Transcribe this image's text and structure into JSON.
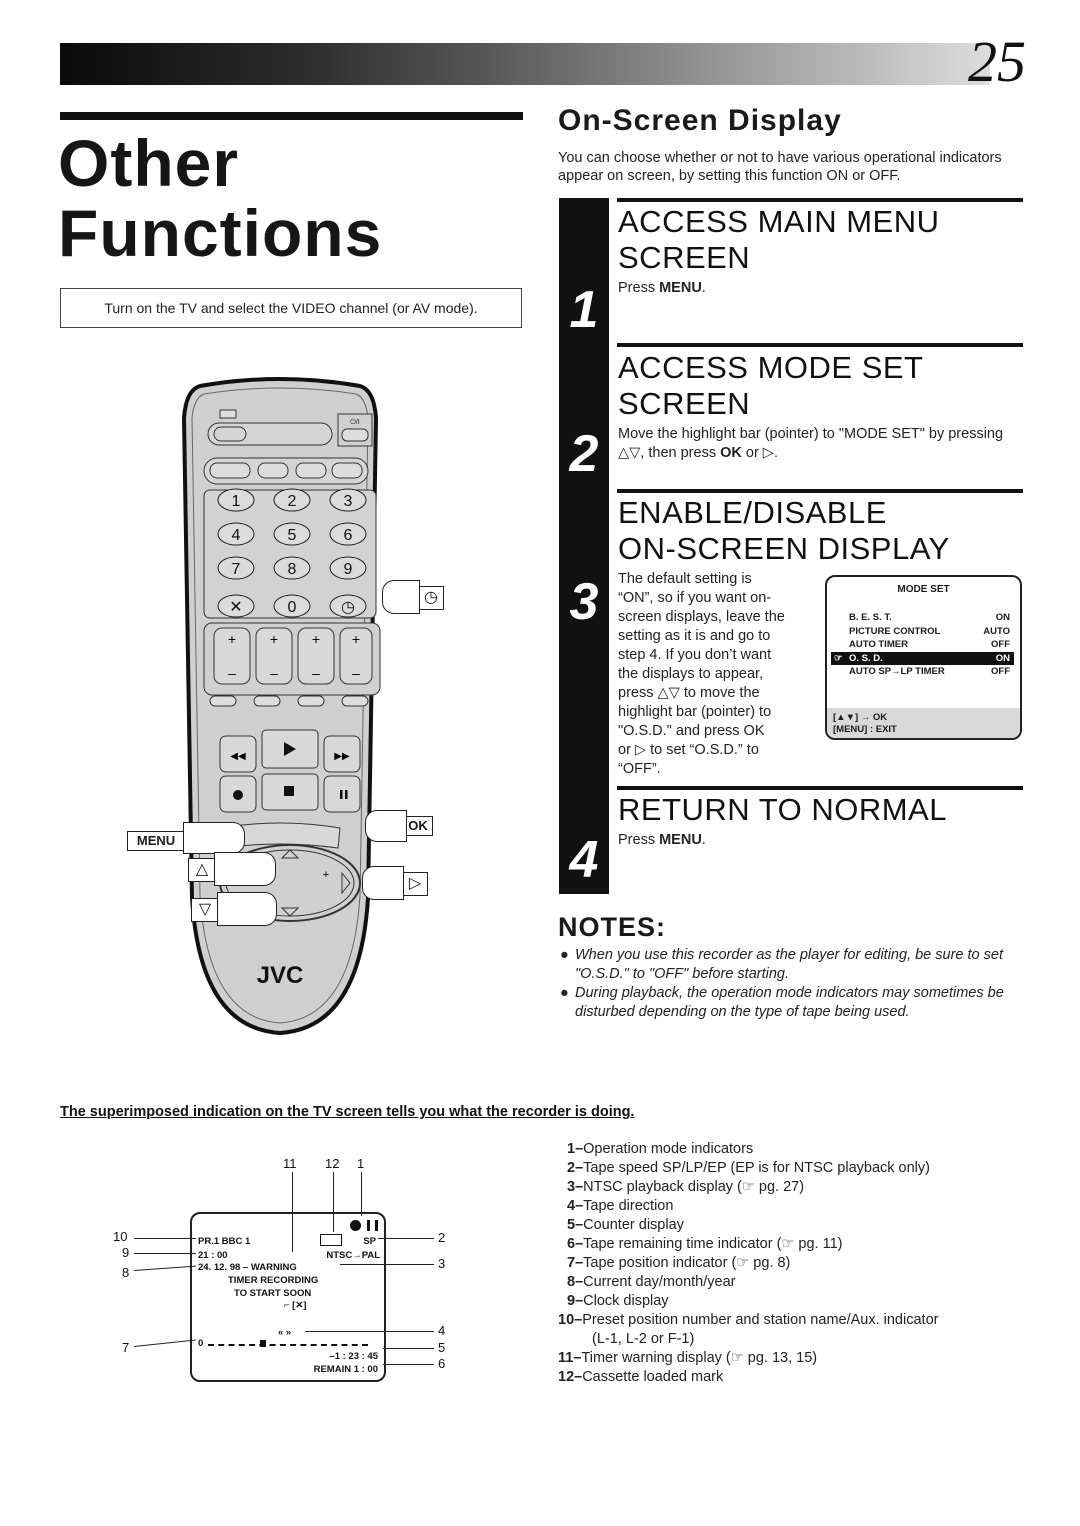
{
  "page": {
    "number": "25",
    "title_lines": [
      "Other",
      "Functions"
    ],
    "tv_instruction": "Turn on the TV and select the VIDEO channel (or AV mode)."
  },
  "section": {
    "heading": "On-Screen Display",
    "intro": "You can choose whether or not to have various operational indicators appear on screen, by setting this function ON or OFF."
  },
  "steps": [
    {
      "number": "1",
      "heading_lines": [
        "ACCESS MAIN MENU",
        "SCREEN"
      ],
      "text_pre": "Press ",
      "text_bold": "MENU",
      "text_post": "."
    },
    {
      "number": "2",
      "heading_lines": [
        "ACCESS MODE SET",
        "SCREEN"
      ],
      "text_pre": "Move the highlight bar (pointer) to \"MODE SET\" by pressing △▽, then press ",
      "text_bold": "OK",
      "text_post": " or ▷."
    },
    {
      "number": "3",
      "heading_lines": [
        "ENABLE/DISABLE",
        "ON-SCREEN DISPLAY"
      ],
      "lines": [
        "The default setting is",
        "“ON”, so if you want on-",
        "screen displays, leave the",
        "setting as it is and go to",
        "step 4. If you don’t want",
        "the displays to appear,",
        "press △▽ to move the",
        "highlight bar (pointer) to",
        "\"O.S.D.\" and press OK",
        "or ▷ to set “O.S.D.” to",
        "“OFF”."
      ]
    },
    {
      "number": "4",
      "heading_lines": [
        "RETURN TO NORMAL"
      ],
      "text_pre": "Press ",
      "text_bold": "MENU",
      "text_post": "."
    }
  ],
  "mode_set_screen": {
    "title": "MODE SET",
    "rows": [
      {
        "label": "B. E. S. T.",
        "value": "ON",
        "selected": false
      },
      {
        "label": "PICTURE CONTROL",
        "value": "AUTO",
        "selected": false
      },
      {
        "label": "AUTO TIMER",
        "value": "OFF",
        "selected": false
      },
      {
        "label": "O. S. D.",
        "value": "ON",
        "selected": true
      },
      {
        "label": "AUTO SP→LP TIMER",
        "value": "OFF",
        "selected": false
      }
    ],
    "footer_line1": "[▲▼] → OK",
    "footer_line2": "[MENU] : EXIT",
    "pointer_icon": "pointer-hand-icon"
  },
  "notes": {
    "title": "NOTES:",
    "items": [
      "When you use this recorder as the player for editing, be sure to set \"O.S.D.\" to \"OFF\" before starting.",
      "During playback, the operation mode indicators may sometimes be disturbed depending on the type of tape being used."
    ]
  },
  "superimposed_heading": "The superimposed indication on the TV screen tells you what the recorder is doing.",
  "tv_screen": {
    "channel": "PR.1 BBC 1",
    "clock": "21 : 00",
    "date_warning": "24. 12. 98 – WARNING",
    "warning_line2": "TIMER RECORDING",
    "warning_line3": "TO START SOON",
    "tape_speed": "SP",
    "ntsc_pal": "NTSC→PAL",
    "direction": "«  »",
    "position_zero": "0",
    "counter": "–1 : 23 : 45",
    "remain": "REMAIN 1 : 00",
    "callouts_top": [
      "11",
      "12",
      "1"
    ],
    "callouts_left": [
      "10",
      "9",
      "8",
      "7"
    ],
    "callouts_right": [
      "2",
      "3",
      "4",
      "5",
      "6"
    ]
  },
  "legend": [
    {
      "num": "1–",
      "text": "Operation mode indicators"
    },
    {
      "num": "2–",
      "text": "Tape speed SP/LP/EP (EP is for NTSC playback only)"
    },
    {
      "num": "3–",
      "text": "NTSC playback display (☞ pg. 27)"
    },
    {
      "num": "4–",
      "text": "Tape direction"
    },
    {
      "num": "5–",
      "text": "Counter display"
    },
    {
      "num": "6–",
      "text": "Tape remaining time indicator (☞ pg. 11)"
    },
    {
      "num": "7–",
      "text": "Tape position indicator (☞ pg. 8)"
    },
    {
      "num": "8–",
      "text": "Current day/month/year"
    },
    {
      "num": "9–",
      "text": "Clock display"
    },
    {
      "num": "10–",
      "text": "Preset position number and station name/Aux. indicator"
    },
    {
      "num": "",
      "text": "(L-1, L-2 or F-1)"
    },
    {
      "num": "11–",
      "text": "Timer warning display (☞ pg. 13, 15)"
    },
    {
      "num": "12–",
      "text": "Cassette loaded mark"
    }
  ],
  "remote": {
    "brand": "JVC",
    "keypad": [
      "1",
      "2",
      "3",
      "4",
      "5",
      "6",
      "7",
      "8",
      "9",
      "✕",
      "0",
      "◷"
    ],
    "callout_menu": "MENU",
    "callout_ok": "OK",
    "callout_up": "△",
    "callout_down": "▽",
    "callout_right": "▷",
    "callout_timer": "◷",
    "power_label": "⏻/I"
  }
}
